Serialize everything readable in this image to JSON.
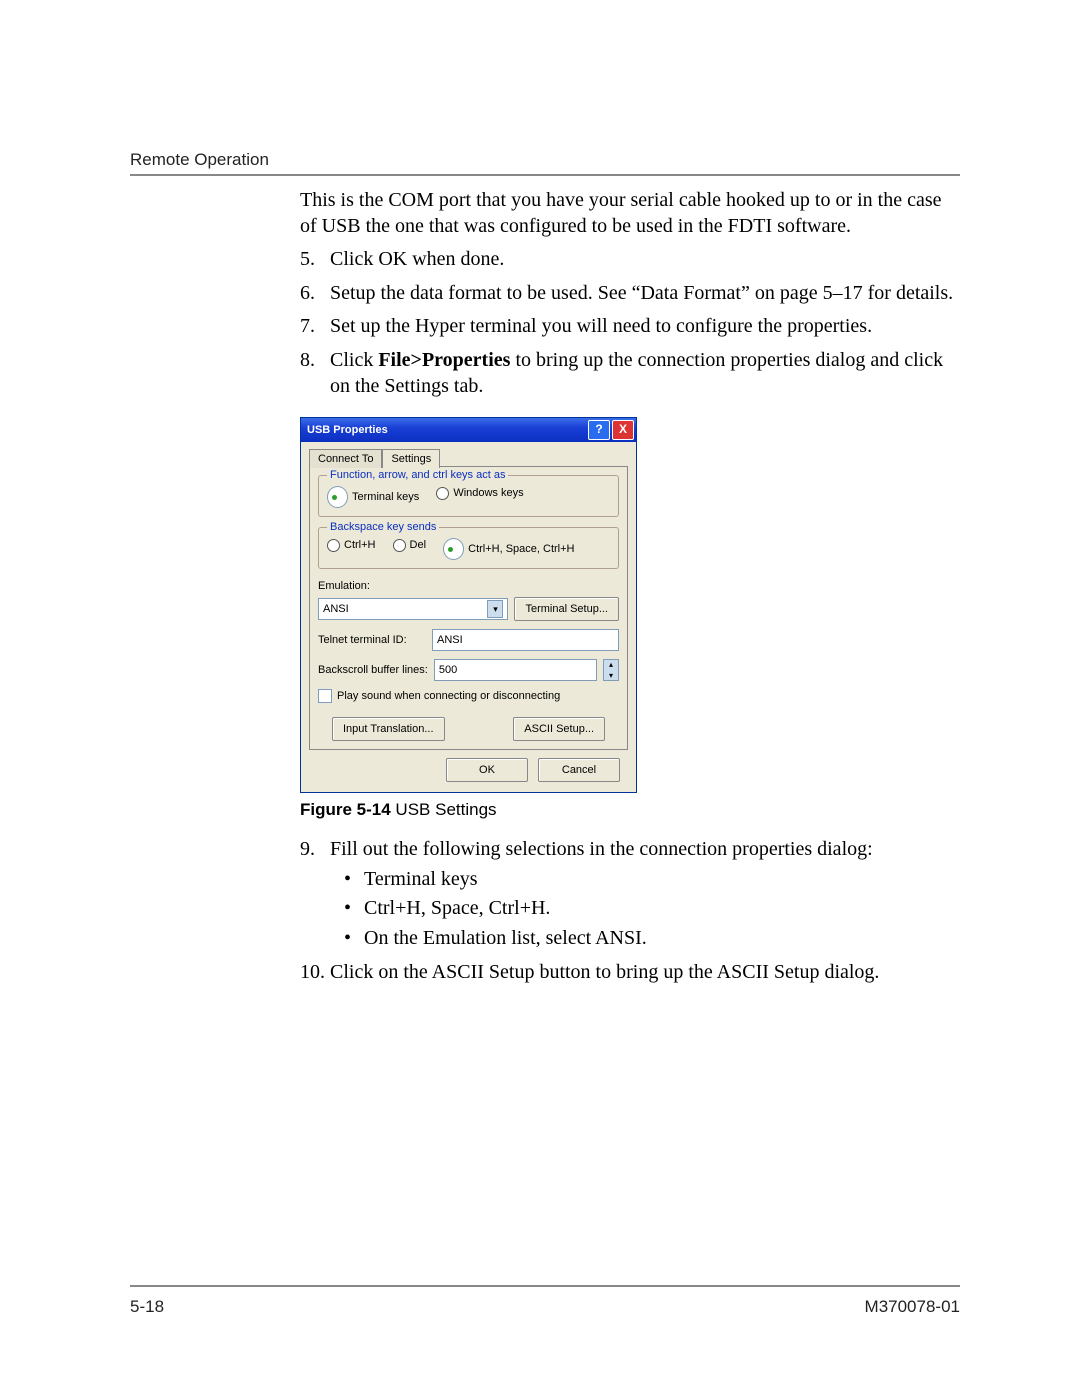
{
  "header": {
    "section": "Remote Operation"
  },
  "intro": "This is the COM port that you have your serial cable hooked up to or in the case of USB the one that was configured to be used in the FDTI software.",
  "steps": {
    "s5": {
      "n": "5.",
      "text": "Click OK when done."
    },
    "s6": {
      "n": "6.",
      "text": "Setup the data format to be used. See “Data Format” on page 5–17 for details."
    },
    "s7": {
      "n": "7.",
      "text": "Set up the Hyper terminal you will need to configure the properties."
    },
    "s8": {
      "n": "8.",
      "pre": "Click ",
      "bold": "File>Properties",
      "post": " to bring up the connection properties dialog and click on the Settings tab."
    },
    "s9": {
      "n": "9.",
      "text": "Fill out the following selections in the connection properties dialog:",
      "bullets": {
        "b1": "Terminal keys",
        "b2": "Ctrl+H, Space, Ctrl+H.",
        "b3": "On the Emulation list, select ANSI."
      }
    },
    "s10": {
      "n": "10.",
      "text": "Click on the ASCII Setup button to bring up the ASCII Setup dialog."
    }
  },
  "dialog": {
    "title": "USB Properties",
    "tabs": {
      "t1": "Connect To",
      "t2": "Settings"
    },
    "group1": {
      "title": "Function, arrow, and ctrl keys act as",
      "r1": "Terminal keys",
      "r2": "Windows keys"
    },
    "group2": {
      "title": "Backspace key sends",
      "r1": "Ctrl+H",
      "r2": "Del",
      "r3": "Ctrl+H, Space, Ctrl+H"
    },
    "emulation_label": "Emulation:",
    "emulation_value": "ANSI",
    "terminal_setup": "Terminal Setup...",
    "telnet_label": "Telnet terminal ID:",
    "telnet_value": "ANSI",
    "backscroll_label": "Backscroll buffer lines:",
    "backscroll_value": "500",
    "playsound": "Play sound when connecting or disconnecting",
    "input_translation": "Input Translation...",
    "ascii_setup": "ASCII Setup...",
    "ok": "OK",
    "cancel": "Cancel"
  },
  "figure": {
    "label": "Figure 5-14",
    "caption": "  USB Settings"
  },
  "footer": {
    "page": "5-18",
    "doc": "M370078-01"
  }
}
